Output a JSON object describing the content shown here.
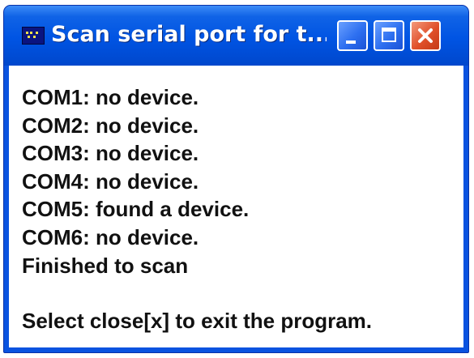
{
  "window": {
    "title": "Scan serial port for t...",
    "controls": {
      "minimize_icon": "minimize-icon",
      "maximize_icon": "maximize-icon",
      "close_icon": "close-icon"
    }
  },
  "output": {
    "lines": [
      "COM1: no device.",
      "COM2: no device.",
      "COM3: no device.",
      "COM4: no device.",
      "COM5: found a device.",
      "COM6: no device.",
      "Finished to scan"
    ],
    "footer": "Select close[x] to exit the program."
  },
  "colors": {
    "titlebar": "#0054e3",
    "close_button": "#e0502a",
    "text": "#111111"
  }
}
